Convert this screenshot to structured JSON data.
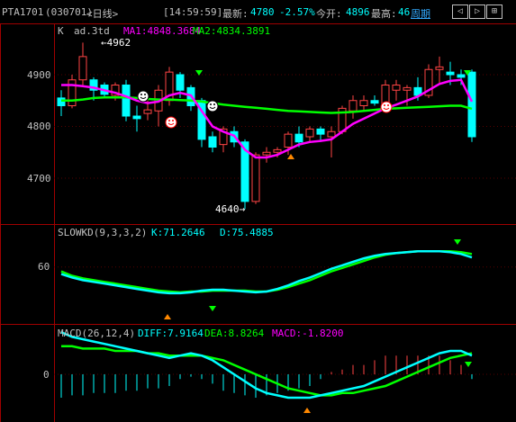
{
  "header": {
    "symbol": "PTA1701",
    "code": "(030701)",
    "period_label": "<日线>",
    "time": "[14:59:59]",
    "latest_label": "最新:",
    "latest_value": "4780",
    "change_pct": "-2.57%",
    "open_label": "今开:",
    "open_value": "4896",
    "high_label": "最高:",
    "high_value": "46",
    "period_button": "周期",
    "nav_buttons": [
      "◁",
      "▷",
      "⊞"
    ]
  },
  "price_panel": {
    "k_label": "K",
    "indicator": "ad.3td",
    "ma1": "MA1:4848.3684",
    "ma2": "MA2:4834.3891",
    "high_marker": "4962",
    "low_marker": "4640",
    "y_ticks": [
      "4900",
      "4800",
      "4700"
    ]
  },
  "kd_panel": {
    "title": "SLOWKD(9,3,3,2)",
    "k": "K:71.2646",
    "d": "D:75.4885",
    "y_ticks": [
      "60"
    ]
  },
  "macd_panel": {
    "title": "MACD(26,12,4)",
    "diff": "DIFF:7.9164",
    "dea": "DEA:8.8264",
    "macd": "MACD:-1.8200",
    "y_ticks": [
      "0"
    ]
  },
  "colors": {
    "up": "#ff4444",
    "down": "#00ffff",
    "ma1": "#ff00ff",
    "ma2": "#00ff00",
    "accent": "#33aaff",
    "warn": "#ff8800"
  },
  "chart_data": {
    "type": "candlestick",
    "candles": [
      {
        "o": 4855,
        "h": 4870,
        "l": 4820,
        "c": 4840
      },
      {
        "o": 4840,
        "h": 4900,
        "l": 4835,
        "c": 4890
      },
      {
        "o": 4890,
        "h": 4962,
        "l": 4880,
        "c": 4935
      },
      {
        "o": 4890,
        "h": 4895,
        "l": 4850,
        "c": 4870
      },
      {
        "o": 4880,
        "h": 4885,
        "l": 4855,
        "c": 4862
      },
      {
        "o": 4860,
        "h": 4885,
        "l": 4850,
        "c": 4880
      },
      {
        "o": 4880,
        "h": 4890,
        "l": 4810,
        "c": 4820
      },
      {
        "o": 4820,
        "h": 4840,
        "l": 4790,
        "c": 4815
      },
      {
        "o": 4825,
        "h": 4850,
        "l": 4812,
        "c": 4832
      },
      {
        "o": 4830,
        "h": 4880,
        "l": 4800,
        "c": 4870
      },
      {
        "o": 4850,
        "h": 4915,
        "l": 4840,
        "c": 4905
      },
      {
        "o": 4900,
        "h": 4905,
        "l": 4855,
        "c": 4870
      },
      {
        "o": 4875,
        "h": 4880,
        "l": 4830,
        "c": 4840
      },
      {
        "o": 4850,
        "h": 4855,
        "l": 4760,
        "c": 4775
      },
      {
        "o": 4780,
        "h": 4790,
        "l": 4750,
        "c": 4760
      },
      {
        "o": 4765,
        "h": 4800,
        "l": 4750,
        "c": 4795
      },
      {
        "o": 4790,
        "h": 4800,
        "l": 4760,
        "c": 4770
      },
      {
        "o": 4770,
        "h": 4775,
        "l": 4640,
        "c": 4655
      },
      {
        "o": 4655,
        "h": 4750,
        "l": 4650,
        "c": 4745
      },
      {
        "o": 4745,
        "h": 4760,
        "l": 4730,
        "c": 4750
      },
      {
        "o": 4750,
        "h": 4760,
        "l": 4740,
        "c": 4755
      },
      {
        "o": 4760,
        "h": 4790,
        "l": 4745,
        "c": 4785
      },
      {
        "o": 4785,
        "h": 4800,
        "l": 4760,
        "c": 4770
      },
      {
        "o": 4780,
        "h": 4800,
        "l": 4770,
        "c": 4795
      },
      {
        "o": 4795,
        "h": 4800,
        "l": 4770,
        "c": 4785
      },
      {
        "o": 4780,
        "h": 4800,
        "l": 4740,
        "c": 4790
      },
      {
        "o": 4790,
        "h": 4840,
        "l": 4785,
        "c": 4835
      },
      {
        "o": 4830,
        "h": 4860,
        "l": 4815,
        "c": 4850
      },
      {
        "o": 4840,
        "h": 4860,
        "l": 4830,
        "c": 4850
      },
      {
        "o": 4850,
        "h": 4860,
        "l": 4840,
        "c": 4845
      },
      {
        "o": 4840,
        "h": 4890,
        "l": 4830,
        "c": 4880
      },
      {
        "o": 4870,
        "h": 4890,
        "l": 4850,
        "c": 4880
      },
      {
        "o": 4870,
        "h": 4880,
        "l": 4840,
        "c": 4875
      },
      {
        "o": 4875,
        "h": 4895,
        "l": 4850,
        "c": 4860
      },
      {
        "o": 4860,
        "h": 4920,
        "l": 4855,
        "c": 4910
      },
      {
        "o": 4910,
        "h": 4935,
        "l": 4880,
        "c": 4915
      },
      {
        "o": 4905,
        "h": 4925,
        "l": 4880,
        "c": 4900
      },
      {
        "o": 4900,
        "h": 4910,
        "l": 4880,
        "c": 4895
      },
      {
        "o": 4905,
        "h": 4910,
        "l": 4770,
        "c": 4780
      }
    ],
    "ma1": [
      4880,
      4880,
      4878,
      4875,
      4870,
      4865,
      4858,
      4850,
      4845,
      4848,
      4860,
      4865,
      4860,
      4830,
      4800,
      4790,
      4782,
      4755,
      4740,
      4740,
      4745,
      4755,
      4765,
      4770,
      4772,
      4775,
      4790,
      4805,
      4815,
      4825,
      4835,
      4842,
      4850,
      4858,
      4870,
      4882,
      4888,
      4890,
      4848
    ],
    "ma2": [
      4850,
      4850,
      4852,
      4855,
      4856,
      4856,
      4856,
      4855,
      4853,
      4852,
      4852,
      4851,
      4850,
      4848,
      4845,
      4842,
      4840,
      4838,
      4836,
      4834,
      4832,
      4830,
      4829,
      4828,
      4827,
      4826,
      4827,
      4828,
      4830,
      4832,
      4834,
      4835,
      4836,
      4837,
      4838,
      4839,
      4840,
      4840,
      4834
    ],
    "kd_k": [
      52,
      48,
      45,
      43,
      41,
      39,
      37,
      35,
      33,
      31,
      30,
      30,
      31,
      33,
      34,
      34,
      33,
      32,
      31,
      32,
      35,
      39,
      44,
      48,
      53,
      58,
      62,
      66,
      70,
      73,
      75,
      76,
      77,
      78,
      78,
      78,
      77,
      75,
      71
    ],
    "kd_d": [
      55,
      50,
      47,
      45,
      43,
      41,
      39,
      37,
      35,
      33,
      32,
      31,
      32,
      32,
      33,
      33,
      33,
      33,
      32,
      32,
      34,
      37,
      41,
      45,
      50,
      55,
      59,
      63,
      67,
      71,
      74,
      76,
      77,
      78,
      78,
      78,
      78,
      77,
      75
    ],
    "macd_diff": [
      18,
      16,
      15,
      14,
      13,
      12,
      11,
      10,
      9,
      8,
      7,
      8,
      9,
      8,
      6,
      3,
      0,
      -3,
      -6,
      -8,
      -9,
      -10,
      -10,
      -10,
      -9,
      -8,
      -7,
      -6,
      -5,
      -3,
      -1,
      1,
      3,
      5,
      7,
      9,
      10,
      10,
      8
    ],
    "macd_dea": [
      12,
      12,
      11,
      11,
      11,
      10,
      10,
      10,
      9,
      9,
      8,
      8,
      8,
      8,
      7,
      6,
      4,
      2,
      0,
      -2,
      -4,
      -6,
      -7,
      -8,
      -9,
      -9,
      -8,
      -8,
      -7,
      -6,
      -5,
      -3,
      -1,
      1,
      3,
      5,
      7,
      8,
      9
    ],
    "macd_bar": [
      -10,
      -9,
      -9,
      -8,
      -8,
      -8,
      -7,
      -7,
      -6,
      -6,
      -5,
      -2,
      -1,
      -2,
      -4,
      -7,
      -8,
      -9,
      -10,
      -9,
      -8,
      -7,
      -6,
      -5,
      -2,
      1,
      2,
      4,
      4,
      6,
      8,
      8,
      8,
      8,
      8,
      8,
      6,
      4,
      -2
    ]
  }
}
